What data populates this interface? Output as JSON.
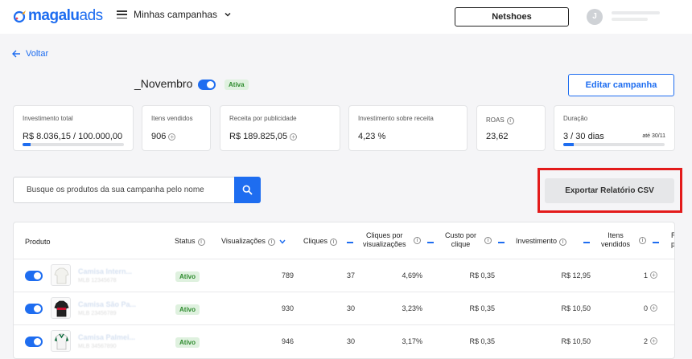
{
  "header": {
    "logo_main": "magalu",
    "logo_suffix": "ads",
    "menu_label": "Minhas campanhas",
    "account_button": "Netshoes",
    "avatar_initial": "J"
  },
  "back_label": "Voltar",
  "campaign": {
    "title": "_Novembro",
    "status": "Ativa",
    "edit_button": "Editar campanha"
  },
  "metrics": {
    "investment": {
      "label": "Investimento total",
      "value": "R$ 8.036,15 / 100.000,00",
      "progress": 0.08
    },
    "items_sold": {
      "label": "Itens vendidos",
      "value": "906"
    },
    "revenue": {
      "label": "Receita por publicidade",
      "value": "R$ 189.825,05"
    },
    "roi": {
      "label": "Investimento sobre receita",
      "value": "4,23 %"
    },
    "roas": {
      "label": "ROAS",
      "value": "23,62"
    },
    "duration": {
      "label": "Duração",
      "value": "3 / 30 dias",
      "until": "até 30/11",
      "progress": 0.1
    }
  },
  "search": {
    "placeholder": "Busque os produtos da sua campanha pelo nome"
  },
  "export_button": "Exportar Relatório CSV",
  "table": {
    "headers": {
      "product": "Produto",
      "status": "Status",
      "views": "Visualizações",
      "clicks": "Cliques",
      "ctr_line1": "Cliques por",
      "ctr_line2": "visualizações",
      "cpc_line1": "Custo por",
      "cpc_line2": "clique",
      "investment": "Investimento",
      "items_line1": "Itens",
      "items_line2": "vendidos",
      "next_line1": "R",
      "next_line2": "p"
    },
    "rows": [
      {
        "name": "Camisa Intern...",
        "sku": "MLB 12345678",
        "status": "Ativo",
        "views": "789",
        "clicks": "37",
        "ctr": "4,69%",
        "cpc": "R$ 0,35",
        "investment": "R$ 12,95",
        "items": "1"
      },
      {
        "name": "Camisa São Pa...",
        "sku": "MLB 23456789",
        "status": "Ativo",
        "views": "930",
        "clicks": "30",
        "ctr": "3,23%",
        "cpc": "R$ 0,35",
        "investment": "R$ 10,50",
        "items": "0"
      },
      {
        "name": "Camisa Palmei...",
        "sku": "MLB 34567890",
        "status": "Ativo",
        "views": "946",
        "clicks": "30",
        "ctr": "3,17%",
        "cpc": "R$ 0,35",
        "investment": "R$ 10,50",
        "items": "2"
      }
    ]
  },
  "colors": {
    "brand": "#1e6df0",
    "highlight": "#e31b1b",
    "status_green": "#2c8a2c"
  }
}
